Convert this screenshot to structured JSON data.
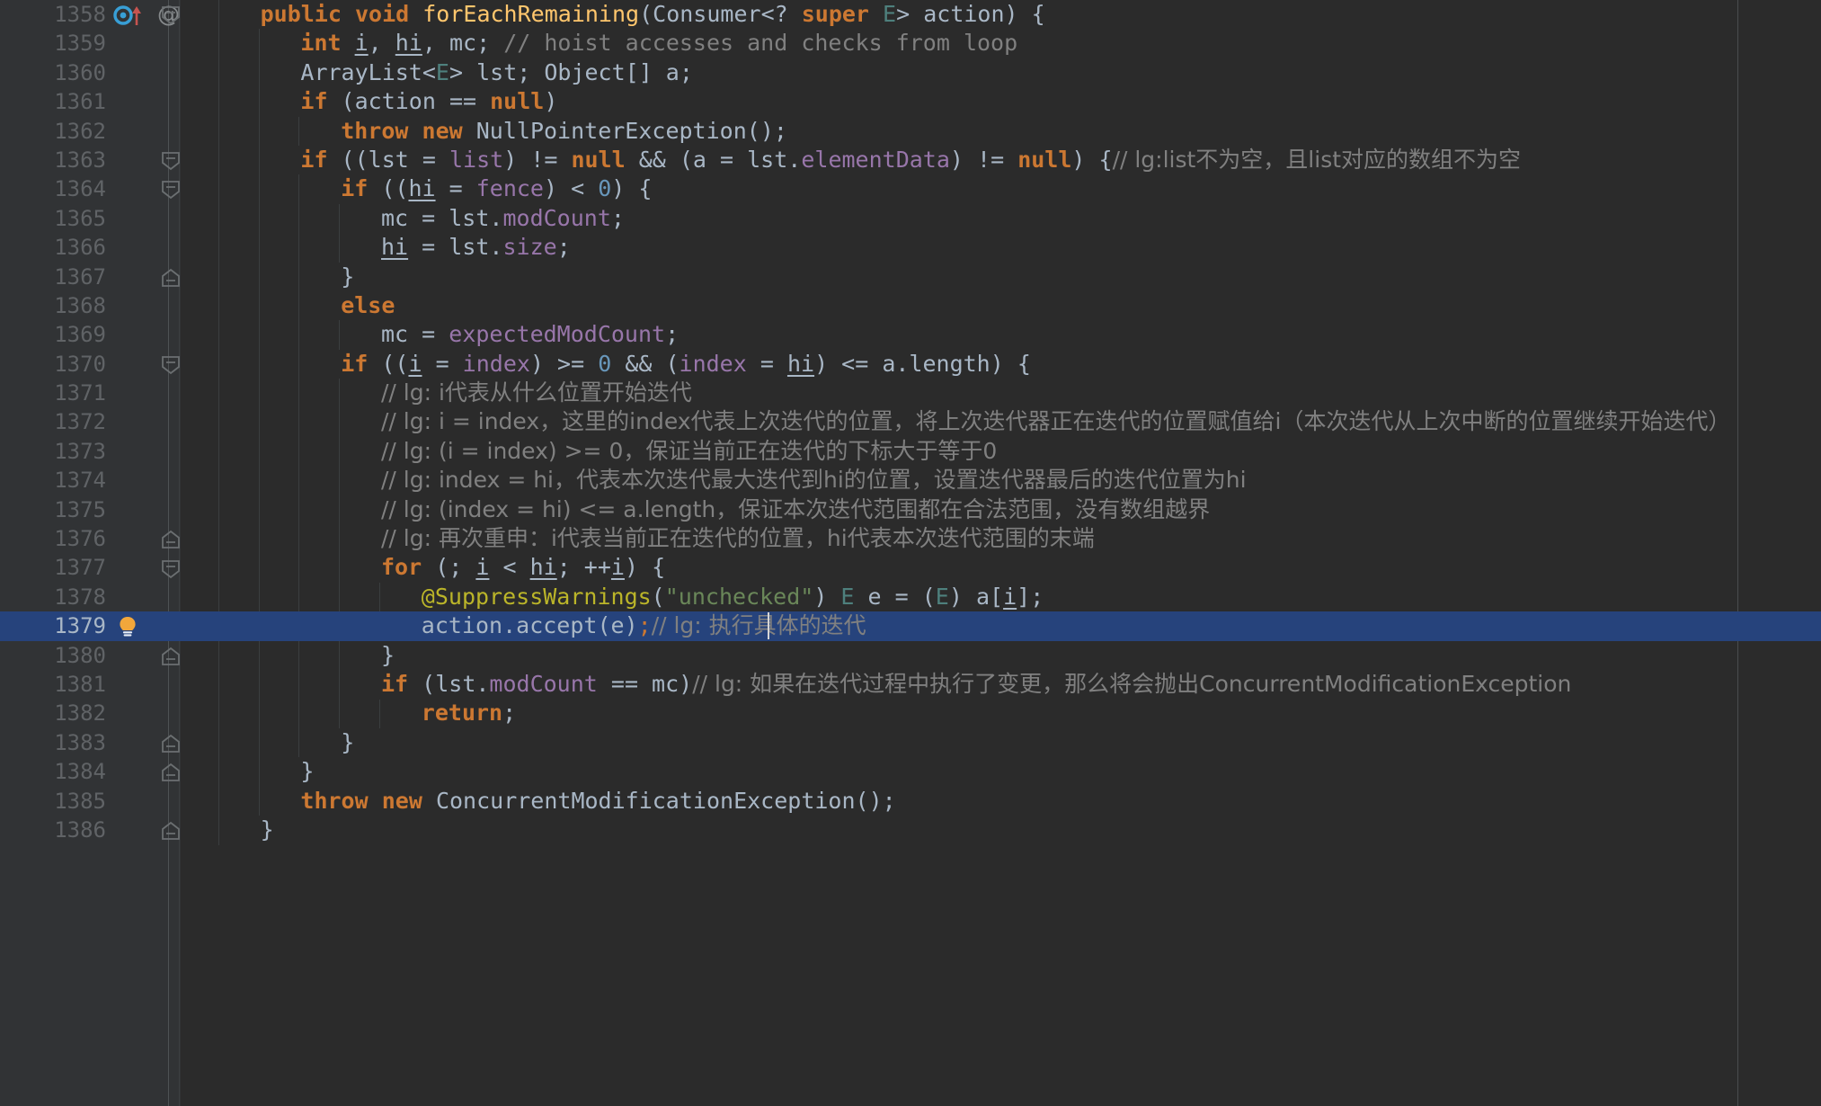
{
  "editor": {
    "theme": "darcula",
    "background": "#2b2b2b",
    "gutter_background": "#313335",
    "selection_color": "#26437c",
    "line_number_color": "#606366",
    "font_size_px": 25,
    "line_height_px": 32.4,
    "selected_line_number": 1379,
    "caret_line": 1379,
    "right_margin_column_x": 1933
  },
  "colors": {
    "keyword": "#cc7832",
    "method": "#ffc66d",
    "string": "#6a8759",
    "field": "#9876aa",
    "comment": "#808080",
    "annotation": "#bbb529",
    "generic_type": "#4e807d",
    "number": "#6897bb",
    "default_text": "#a9b7c6"
  },
  "gutter_icons": {
    "override_marker": {
      "line": 1358,
      "name": "implementing-method-icon",
      "circle_color": "#389fd6",
      "arrow_color": "#c75450"
    },
    "annotation_marker": {
      "line": 1358,
      "glyph": "@",
      "color": "#868a8c"
    },
    "intention_bulb": {
      "line": 1379,
      "name": "intention-bulb-icon",
      "color": "#f2a73b"
    },
    "fold_lines_down": [
      1358,
      1363,
      1364,
      1370,
      1377
    ],
    "fold_lines_up": [
      1367,
      1376,
      1380,
      1383,
      1384,
      1386
    ]
  },
  "code": {
    "lines": [
      {
        "n": 1358,
        "indent": 2,
        "tokens": [
          {
            "t": "public",
            "c": "kw"
          },
          {
            "t": " ",
            "c": "pun"
          },
          {
            "t": "void",
            "c": "kw"
          },
          {
            "t": " ",
            "c": "pun"
          },
          {
            "t": "forEachRemaining",
            "c": "mth"
          },
          {
            "t": "(",
            "c": "pun"
          },
          {
            "t": "Consumer",
            "c": "cls"
          },
          {
            "t": "<? ",
            "c": "pun"
          },
          {
            "t": "super",
            "c": "kw"
          },
          {
            "t": " ",
            "c": "pun"
          },
          {
            "t": "E",
            "c": "gen"
          },
          {
            "t": "> action) {",
            "c": "pun"
          }
        ]
      },
      {
        "n": 1359,
        "indent": 3,
        "tokens": [
          {
            "t": "int",
            "c": "kw"
          },
          {
            "t": " ",
            "c": "pun"
          },
          {
            "t": "i",
            "c": "var-u"
          },
          {
            "t": ", ",
            "c": "pun"
          },
          {
            "t": "hi",
            "c": "var-u"
          },
          {
            "t": ", mc; ",
            "c": "pun"
          },
          {
            "t": "// hoist accesses and checks from loop",
            "c": "cmt"
          }
        ]
      },
      {
        "n": 1360,
        "indent": 3,
        "tokens": [
          {
            "t": "ArrayList",
            "c": "cls"
          },
          {
            "t": "<",
            "c": "pun"
          },
          {
            "t": "E",
            "c": "gen"
          },
          {
            "t": "> lst; ",
            "c": "pun"
          },
          {
            "t": "Object",
            "c": "cls"
          },
          {
            "t": "[] a;",
            "c": "pun"
          }
        ]
      },
      {
        "n": 1361,
        "indent": 3,
        "tokens": [
          {
            "t": "if",
            "c": "kw"
          },
          {
            "t": " (action == ",
            "c": "pun"
          },
          {
            "t": "null",
            "c": "kw"
          },
          {
            "t": ")",
            "c": "pun"
          }
        ]
      },
      {
        "n": 1362,
        "indent": 4,
        "tokens": [
          {
            "t": "throw",
            "c": "kw"
          },
          {
            "t": " ",
            "c": "pun"
          },
          {
            "t": "new",
            "c": "kw"
          },
          {
            "t": " ",
            "c": "pun"
          },
          {
            "t": "NullPointerException",
            "c": "cls"
          },
          {
            "t": "();",
            "c": "pun"
          }
        ]
      },
      {
        "n": 1363,
        "indent": 3,
        "tokens": [
          {
            "t": "if",
            "c": "kw"
          },
          {
            "t": " ((lst = ",
            "c": "pun"
          },
          {
            "t": "list",
            "c": "fld"
          },
          {
            "t": ") != ",
            "c": "pun"
          },
          {
            "t": "null",
            "c": "kw"
          },
          {
            "t": " && (a = lst.",
            "c": "pun"
          },
          {
            "t": "elementData",
            "c": "fld"
          },
          {
            "t": ") != ",
            "c": "pun"
          },
          {
            "t": "null",
            "c": "kw"
          },
          {
            "t": ") {",
            "c": "pun"
          },
          {
            "t": "// lg:list不为空，且list对应的数组不为空",
            "c": "cmt"
          }
        ]
      },
      {
        "n": 1364,
        "indent": 4,
        "tokens": [
          {
            "t": "if",
            "c": "kw"
          },
          {
            "t": " ((",
            "c": "pun"
          },
          {
            "t": "hi",
            "c": "var-u"
          },
          {
            "t": " = ",
            "c": "pun"
          },
          {
            "t": "fence",
            "c": "fld"
          },
          {
            "t": ") < ",
            "c": "pun"
          },
          {
            "t": "0",
            "c": "num"
          },
          {
            "t": ") {",
            "c": "pun"
          }
        ]
      },
      {
        "n": 1365,
        "indent": 5,
        "tokens": [
          {
            "t": "mc = lst.",
            "c": "pun"
          },
          {
            "t": "modCount",
            "c": "fld"
          },
          {
            "t": ";",
            "c": "pun"
          }
        ]
      },
      {
        "n": 1366,
        "indent": 5,
        "tokens": [
          {
            "t": "hi",
            "c": "var-u"
          },
          {
            "t": " = lst.",
            "c": "pun"
          },
          {
            "t": "size",
            "c": "fld"
          },
          {
            "t": ";",
            "c": "pun"
          }
        ]
      },
      {
        "n": 1367,
        "indent": 4,
        "tokens": [
          {
            "t": "}",
            "c": "pun"
          }
        ]
      },
      {
        "n": 1368,
        "indent": 4,
        "tokens": [
          {
            "t": "else",
            "c": "kw"
          }
        ]
      },
      {
        "n": 1369,
        "indent": 5,
        "tokens": [
          {
            "t": "mc = ",
            "c": "pun"
          },
          {
            "t": "expectedModCount",
            "c": "fld"
          },
          {
            "t": ";",
            "c": "pun"
          }
        ]
      },
      {
        "n": 1370,
        "indent": 4,
        "tokens": [
          {
            "t": "if",
            "c": "kw"
          },
          {
            "t": " ((",
            "c": "pun"
          },
          {
            "t": "i",
            "c": "var-u"
          },
          {
            "t": " = ",
            "c": "pun"
          },
          {
            "t": "index",
            "c": "fld"
          },
          {
            "t": ") >= ",
            "c": "pun"
          },
          {
            "t": "0",
            "c": "num"
          },
          {
            "t": " && (",
            "c": "pun"
          },
          {
            "t": "index",
            "c": "fld"
          },
          {
            "t": " = ",
            "c": "pun"
          },
          {
            "t": "hi",
            "c": "var-u"
          },
          {
            "t": ") <= a.length) {",
            "c": "pun"
          }
        ]
      },
      {
        "n": 1371,
        "indent": 5,
        "tokens": [
          {
            "t": "// lg: i代表从什么位置开始迭代",
            "c": "cmt"
          }
        ]
      },
      {
        "n": 1372,
        "indent": 5,
        "tokens": [
          {
            "t": "// lg: i = index，这里的index代表上次迭代的位置，将上次迭代器正在迭代的位置赋值给i（本次迭代从上次中断的位置继续开始迭代）",
            "c": "cmt"
          }
        ]
      },
      {
        "n": 1373,
        "indent": 5,
        "tokens": [
          {
            "t": "// lg: (i = index) >= 0，保证当前正在迭代的下标大于等于0",
            "c": "cmt"
          }
        ]
      },
      {
        "n": 1374,
        "indent": 5,
        "tokens": [
          {
            "t": "// lg: index = hi，代表本次迭代最大迭代到hi的位置，设置迭代器最后的迭代位置为hi",
            "c": "cmt"
          }
        ]
      },
      {
        "n": 1375,
        "indent": 5,
        "tokens": [
          {
            "t": "// lg: (index = hi) <= a.length，保证本次迭代范围都在合法范围，没有数组越界",
            "c": "cmt"
          }
        ]
      },
      {
        "n": 1376,
        "indent": 5,
        "tokens": [
          {
            "t": "// lg: 再次重申：i代表当前正在迭代的位置，hi代表本次迭代范围的末端",
            "c": "cmt"
          }
        ]
      },
      {
        "n": 1377,
        "indent": 5,
        "tokens": [
          {
            "t": "for",
            "c": "kw"
          },
          {
            "t": " (; ",
            "c": "pun"
          },
          {
            "t": "i",
            "c": "var-u"
          },
          {
            "t": " < ",
            "c": "pun"
          },
          {
            "t": "hi",
            "c": "var-u"
          },
          {
            "t": "; ++",
            "c": "pun"
          },
          {
            "t": "i",
            "c": "var-u"
          },
          {
            "t": ") {",
            "c": "pun"
          }
        ]
      },
      {
        "n": 1378,
        "indent": 6,
        "tokens": [
          {
            "t": "@SuppressWarnings",
            "c": "ann"
          },
          {
            "t": "(",
            "c": "pun"
          },
          {
            "t": "\"unchecked\"",
            "c": "str"
          },
          {
            "t": ") ",
            "c": "pun"
          },
          {
            "t": "E",
            "c": "gen"
          },
          {
            "t": " e = (",
            "c": "pun"
          },
          {
            "t": "E",
            "c": "gen"
          },
          {
            "t": ") a[",
            "c": "pun"
          },
          {
            "t": "i",
            "c": "var-u"
          },
          {
            "t": "];",
            "c": "pun"
          }
        ]
      },
      {
        "n": 1379,
        "indent": 6,
        "selected": true,
        "tokens": [
          {
            "t": "action.",
            "c": "pun"
          },
          {
            "t": "accept",
            "c": "pun"
          },
          {
            "t": "(e)",
            "c": "pun"
          },
          {
            "t": ";",
            "c": "kw2"
          },
          {
            "t": "// lg: 执行具体的迭代",
            "c": "cmt"
          }
        ],
        "caret_after_chars": 25
      },
      {
        "n": 1380,
        "indent": 5,
        "tokens": [
          {
            "t": "}",
            "c": "pun"
          }
        ]
      },
      {
        "n": 1381,
        "indent": 5,
        "tokens": [
          {
            "t": "if",
            "c": "kw"
          },
          {
            "t": " (lst.",
            "c": "pun"
          },
          {
            "t": "modCount",
            "c": "fld"
          },
          {
            "t": " == mc)",
            "c": "pun"
          },
          {
            "t": "// lg: 如果在迭代过程中执行了变更，那么将会抛出ConcurrentModificationException",
            "c": "cmt"
          }
        ]
      },
      {
        "n": 1382,
        "indent": 6,
        "tokens": [
          {
            "t": "return",
            "c": "kw"
          },
          {
            "t": ";",
            "c": "pun"
          }
        ]
      },
      {
        "n": 1383,
        "indent": 4,
        "tokens": [
          {
            "t": "}",
            "c": "pun"
          }
        ]
      },
      {
        "n": 1384,
        "indent": 3,
        "tokens": [
          {
            "t": "}",
            "c": "pun"
          }
        ]
      },
      {
        "n": 1385,
        "indent": 3,
        "tokens": [
          {
            "t": "throw",
            "c": "kw"
          },
          {
            "t": " ",
            "c": "pun"
          },
          {
            "t": "new",
            "c": "kw"
          },
          {
            "t": " ",
            "c": "pun"
          },
          {
            "t": "ConcurrentModificationException",
            "c": "cls"
          },
          {
            "t": "();",
            "c": "pun"
          }
        ]
      },
      {
        "n": 1386,
        "indent": 2,
        "tokens": [
          {
            "t": "}",
            "c": "pun"
          }
        ]
      }
    ]
  }
}
